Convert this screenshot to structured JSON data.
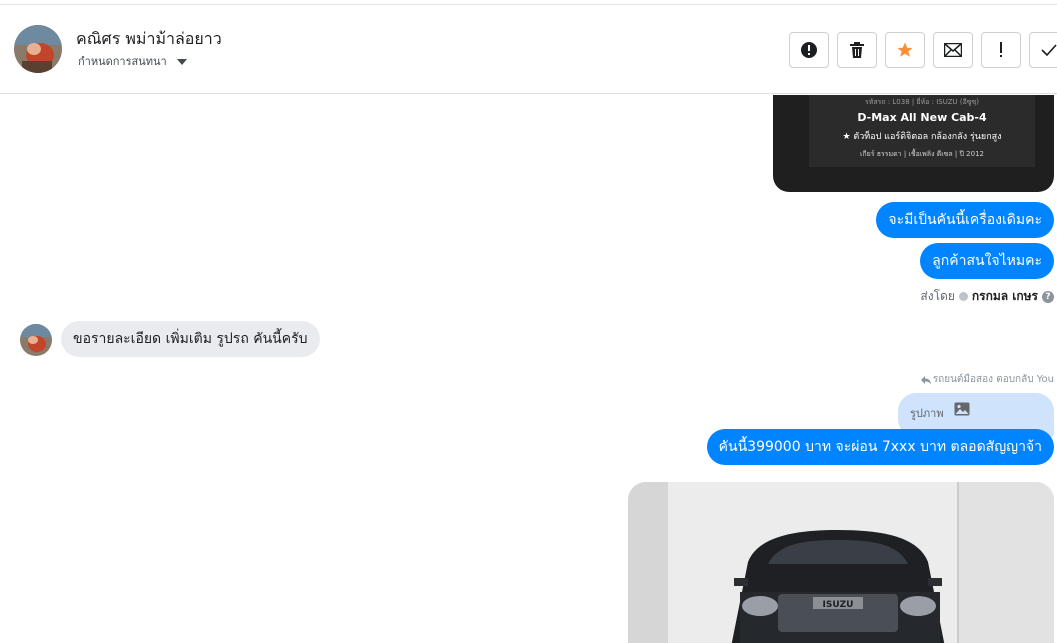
{
  "header": {
    "contact_name": "คณิศร พม่าม้าล่อยาว",
    "assign_label": "กำหนดการสนทนา",
    "actions": [
      {
        "name": "report-icon"
      },
      {
        "name": "trash-icon"
      },
      {
        "name": "star-icon"
      },
      {
        "name": "envelope-icon"
      },
      {
        "name": "exclamation-icon"
      },
      {
        "name": "check-icon"
      }
    ]
  },
  "chat": {
    "card": {
      "meta": "รหัสรถ : L038 | ยี่ห้อ : ISUZU (อีซูซุ)",
      "title": "D-Max All New Cab-4",
      "subtitle": "★ ตัวท็อป แอร์ดิจิตอล กล้องกลัง รุ่นยกสูง",
      "specs": "เกียร์ ธรรมดา  |  เชื้อเพลิง ดีเซล  |  ปี 2012"
    },
    "out_1": "จะมีเป็นคันนี้เครื่องเดิมคะ",
    "out_2": "ลูกค้าสนใจไหมคะ",
    "sent_by_prefix": "ส่งโดย",
    "sent_by_name": "กรกมล เกษร",
    "in_1": "ขอรายละเอียด เพิ่มเติม รูปรถ คันนี้ครับ",
    "reply_note": "รถยนต์มือสอง ตอบกลับ You",
    "quoted_label": "รูปภาพ",
    "out_3": "คันนี้399000 บาท จะผ่อน 7xxx บาท ตลอดสัญญาจ้า",
    "photo_brand_text": "ISUZU"
  },
  "colors": {
    "accent": "#0084ff",
    "incoming_bubble": "#e9ebee",
    "quoted_bubble": "#cfe3fc",
    "star": "#f7923b"
  }
}
